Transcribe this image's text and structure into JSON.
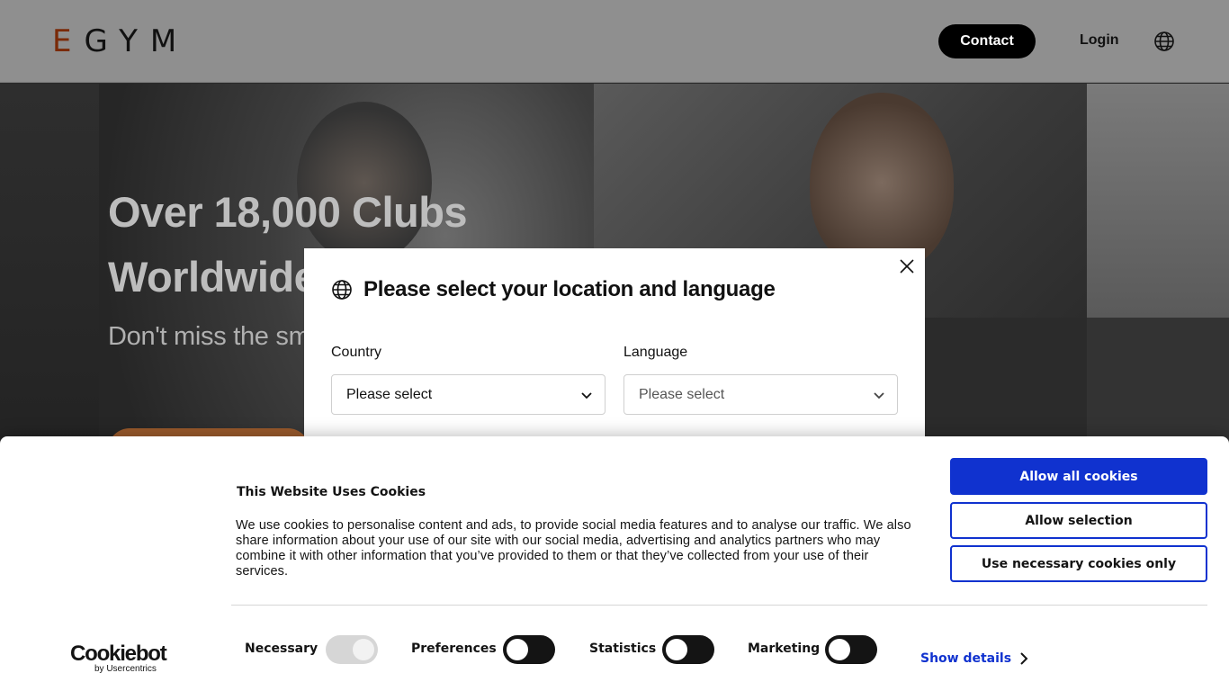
{
  "header": {
    "logo_first": "E",
    "logo_rest": "GYM",
    "contact_label": "Contact",
    "login_label": "Login",
    "language_icon": "globe-icon"
  },
  "hero": {
    "title_line1": "Over 18,000 Clubs",
    "title_line2": "Worldwide",
    "subtitle": "Don't miss the sm"
  },
  "location_modal": {
    "title": "Please select your location and language",
    "country_label": "Country",
    "country_value": "Please select",
    "language_label": "Language",
    "language_value": "Please select",
    "close_icon": "close-icon"
  },
  "cookie_banner": {
    "title": "This Website Uses Cookies",
    "body": "We use cookies to personalise content and ads, to provide social media features and to analyse our traffic. We also share information about your use of our site with our social media, advertising and analytics partners who may combine it with other information that you’ve provided to them or that they’ve collected from your use of their services.",
    "allow_all_label": "Allow all cookies",
    "allow_selection_label": "Allow selection",
    "necessary_only_label": "Use necessary cookies only",
    "logo_text": "Cookiebot",
    "logo_sub": "by Usercentrics",
    "toggles": [
      {
        "label": "Necessary",
        "on": true,
        "disabled": true
      },
      {
        "label": "Preferences",
        "on": false,
        "disabled": false
      },
      {
        "label": "Statistics",
        "on": false,
        "disabled": false
      },
      {
        "label": "Marketing",
        "on": false,
        "disabled": false
      }
    ],
    "show_details_label": "Show details"
  },
  "colors": {
    "accent_blue": "#1032cf",
    "logo_e": "#7a2a08",
    "cta_orange": "#9a5a2c"
  }
}
